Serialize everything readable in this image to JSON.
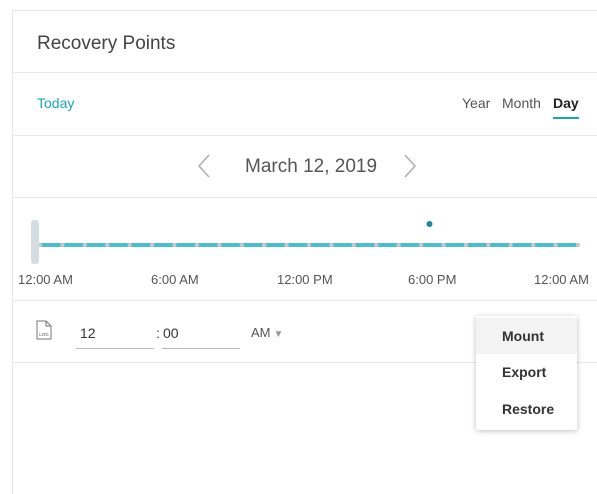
{
  "panel": {
    "title": "Recovery Points"
  },
  "nav": {
    "today_label": "Today",
    "periods": [
      "Year",
      "Month",
      "Day"
    ],
    "active_period": "Day"
  },
  "date_nav": {
    "date_label": "March 12, 2019"
  },
  "timeline": {
    "tick_labels": [
      "12:00 AM",
      "6:00 AM",
      "12:00 PM",
      "6:00 PM",
      "12:00 AM"
    ],
    "track_color": "#4dbdca",
    "marker_color": "#1a8a9a",
    "selected_range": [
      0.0,
      1.0
    ],
    "recovery_point_fraction": 0.726
  },
  "time_picker": {
    "log_icon_label": "LOG",
    "hour": "12",
    "minute": "00",
    "colon": ":",
    "ampm": "AM"
  },
  "context_menu": {
    "items": [
      "Mount",
      "Export",
      "Restore"
    ],
    "highlighted": "Mount"
  },
  "accent_color": "#1aa6b7"
}
